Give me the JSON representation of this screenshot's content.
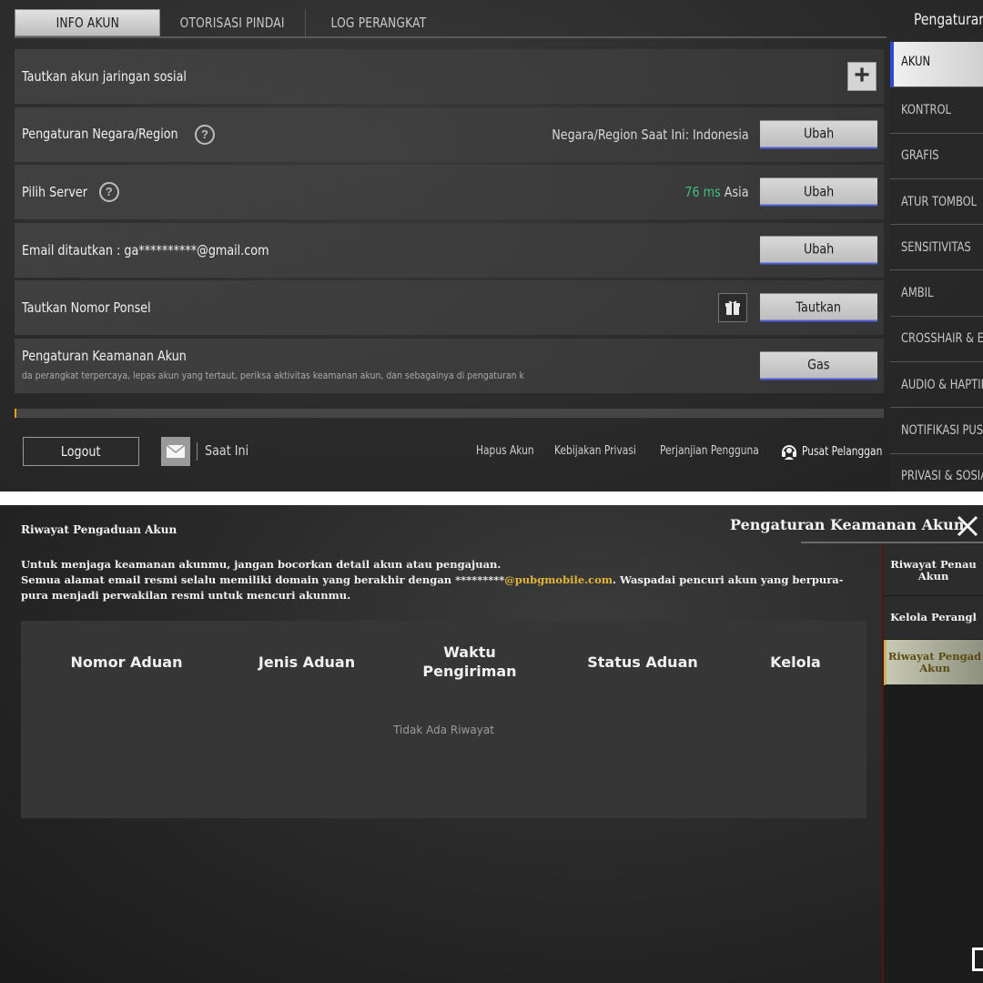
{
  "top": {
    "tabs": [
      "INFO AKUN",
      "OTORISASI PINDAI",
      "LOG PERANGKAT"
    ],
    "right_title": "Pengaturan",
    "rows": {
      "social": {
        "label": "Tautkan akun jaringan sosial",
        "add_icon": "plus-icon"
      },
      "region": {
        "label": "Pengaturan Negara/Region",
        "current": "Negara/Region Saat Ini: Indonesia",
        "button": "Ubah"
      },
      "server": {
        "label": "Pilih Server",
        "ping": "76 ms",
        "region": "Asia",
        "button": "Ubah"
      },
      "email": {
        "label": "Email ditautkan : ga**********@gmail.com",
        "button": "Ubah"
      },
      "phone": {
        "label": "Tautkan Nomor Ponsel",
        "button": "Tautkan",
        "gift_icon": "gift-icon"
      },
      "security": {
        "label": "Pengaturan Keamanan Akun",
        "sub": "da perangkat terpercaya, lepas akun yang tertaut, periksa aktivitas keamanan akun, dan sebagainya di pengaturan k",
        "button": "Gas"
      }
    },
    "progress": 0.002,
    "footer": {
      "logout": "Logout",
      "status": "Saat Ini",
      "links": [
        "Hapus Akun",
        "Kebijakan Privasi",
        "Perjanjian Pengguna"
      ],
      "support": "Pusat Pelanggan"
    },
    "side_nav": [
      "AKUN",
      "KONTROL",
      "GRAFIS",
      "ATUR TOMBOL",
      "SENSITIVITAS",
      "AMBIL",
      "CROSSHAIR & E",
      "AUDIO & HAPTIK",
      "NOTIFIKASI PUS",
      "PRIVASI & SOSIA"
    ]
  },
  "bottom": {
    "left_title": "Riwayat Pengaduan Akun",
    "main_title": "Pengaturan Keamanan Akun",
    "notice_line1": "Untuk menjaga keamanan akunmu, jangan bocorkan detail akun atau pengajuan.",
    "notice_line2_pre": "Semua alamat email resmi selalu memiliki domain yang berakhir dengan *********",
    "notice_domain": "@pubgmobile.com",
    "notice_line2_post": ". Waspadai pencuri akun yang berpura-pura menjadi perwakilan resmi untuk mencuri akunmu.",
    "columns": [
      "Nomor Aduan",
      "Jenis Aduan",
      "Waktu Pengiriman",
      "Status Aduan",
      "Kelola"
    ],
    "empty": "Tidak Ada Riwayat",
    "side_nav": [
      "Riwayat Penau Akun",
      "Kelola Perangl",
      "Riwayat Pengad Akun"
    ]
  }
}
